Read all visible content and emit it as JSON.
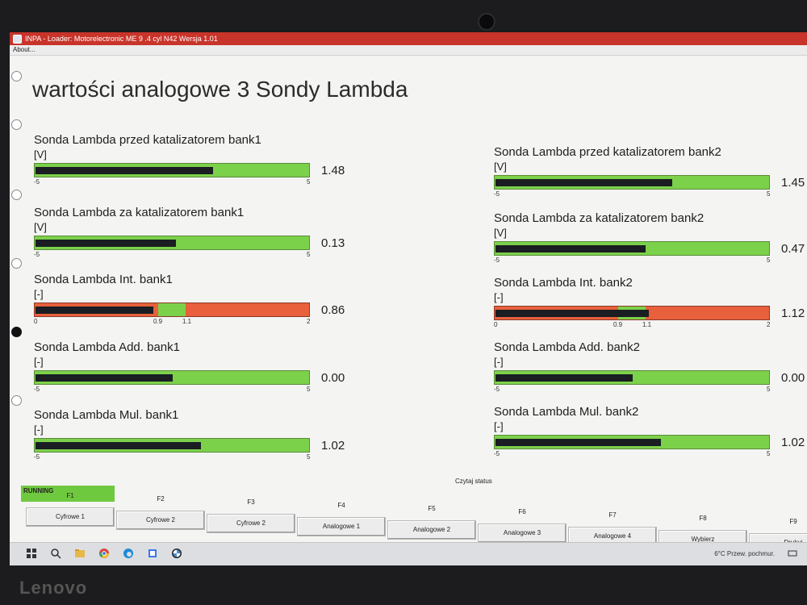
{
  "window": {
    "title": "INPA - Loader: Motorelectronic ME 9 .4 cyl N42 Wersja 1.01",
    "menu": [
      "About..."
    ]
  },
  "page_title": "wartości analogowe 3 Sondy Lambda",
  "gauges_left": [
    {
      "label": "Sonda Lambda przed katalizatorem bank1",
      "unit": "[V]",
      "value": "1.48",
      "min": "-5",
      "max": "5",
      "type": "linear",
      "value_num": 1.48,
      "min_num": -5,
      "max_num": 5
    },
    {
      "label": "Sonda Lambda za katalizatorem bank1",
      "unit": "[V]",
      "value": "0.13",
      "min": "-5",
      "max": "5",
      "type": "linear",
      "value_num": 0.13,
      "min_num": -5,
      "max_num": 5
    },
    {
      "label": "Sonda Lambda Int. bank1",
      "unit": "[-]",
      "value": "0.86",
      "min": "0",
      "max": "2",
      "lo": "0.9",
      "hi": "1.1",
      "type": "window",
      "value_num": 0.86,
      "min_num": 0,
      "max_num": 2,
      "lo_num": 0.9,
      "hi_num": 1.1
    },
    {
      "label": "Sonda Lambda Add. bank1",
      "unit": "[-]",
      "value": "0.00",
      "min": "-5",
      "max": "5",
      "type": "linear",
      "value_num": 0.0,
      "min_num": -5,
      "max_num": 5
    },
    {
      "label": "Sonda Lambda Mul. bank1",
      "unit": "[-]",
      "value": "1.02",
      "min": "-5",
      "max": "5",
      "type": "linear",
      "value_num": 1.02,
      "min_num": -5,
      "max_num": 5
    }
  ],
  "gauges_right": [
    {
      "label": "Sonda Lambda przed katalizatorem bank2",
      "unit": "[V]",
      "value": "1.45",
      "min": "-5",
      "max": "5",
      "type": "linear",
      "value_num": 1.45,
      "min_num": -5,
      "max_num": 5
    },
    {
      "label": "Sonda Lambda za katalizatorem bank2",
      "unit": "[V]",
      "value": "0.47",
      "min": "-5",
      "max": "5",
      "type": "linear",
      "value_num": 0.47,
      "min_num": -5,
      "max_num": 5
    },
    {
      "label": "Sonda Lambda Int. bank2",
      "unit": "[-]",
      "value": "1.12",
      "min": "0",
      "max": "2",
      "lo": "0.9",
      "hi": "1.1",
      "type": "window",
      "value_num": 1.12,
      "min_num": 0,
      "max_num": 2,
      "lo_num": 0.9,
      "hi_num": 1.1
    },
    {
      "label": "Sonda Lambda Add. bank2",
      "unit": "[-]",
      "value": "0.00",
      "min": "-5",
      "max": "5",
      "type": "linear",
      "value_num": 0.0,
      "min_num": -5,
      "max_num": 5
    },
    {
      "label": "Sonda Lambda Mul. bank2",
      "unit": "[-]",
      "value": "1.02",
      "min": "-5",
      "max": "5",
      "type": "linear",
      "value_num": 1.02,
      "min_num": -5,
      "max_num": 5
    }
  ],
  "status": {
    "caption": "Czytaj status",
    "running": "RUNNING"
  },
  "fkeys": [
    {
      "code": "F1",
      "label": "Cyfrowe 1"
    },
    {
      "code": "F2",
      "label": "Cyfrowe 2"
    },
    {
      "code": "F3",
      "label": "Cyfrowe 2"
    },
    {
      "code": "F4",
      "label": "Analogowe 1"
    },
    {
      "code": "F5",
      "label": "Analogowe 2"
    },
    {
      "code": "F6",
      "label": "Analogowe 3"
    },
    {
      "code": "F7",
      "label": "Analogowe 4"
    },
    {
      "code": "F8",
      "label": "Wybierz"
    },
    {
      "code": "F9",
      "label": "Drukuj"
    }
  ],
  "taskbar": {
    "weather": "6°C  Przew. pochmur."
  },
  "bezel": {
    "brand": "Lenovo"
  },
  "colors": {
    "bar_green": "#7cd14a",
    "bar_red": "#e8603c",
    "needle": "#1a1d22",
    "title_bar": "#c8342a"
  }
}
